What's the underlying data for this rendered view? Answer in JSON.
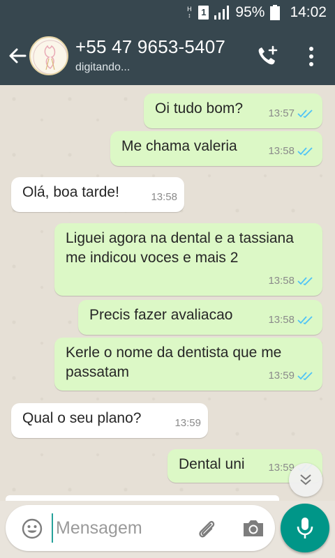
{
  "status_bar": {
    "network": "H",
    "sim": "1",
    "battery": "95%",
    "time": "14:02"
  },
  "header": {
    "contact_name": "+55 47 9653-5407",
    "status": "digitando...",
    "icons": [
      "back-arrow-icon",
      "add-call-icon",
      "more-vert-icon"
    ]
  },
  "messages": [
    {
      "direction": "out",
      "text": "Oi tudo bom?",
      "time": "13:57",
      "read": true
    },
    {
      "direction": "out",
      "text": "Me chama valeria",
      "time": "13:58",
      "read": true
    },
    {
      "direction": "in",
      "text": "Olá, boa tarde!",
      "time": "13:58"
    },
    {
      "direction": "out",
      "text": "Liguei agora na dental e a tassiana me indicou voces e mais 2",
      "time": "13:58",
      "read": true
    },
    {
      "direction": "out",
      "text": "Precis fazer avaliacao",
      "time": "13:58",
      "read": true
    },
    {
      "direction": "out",
      "text": "Kerle o nome da dentista que me passatam",
      "time": "13:59",
      "read": true
    },
    {
      "direction": "in",
      "text": "Qual o seu plano?",
      "time": "13:59"
    },
    {
      "direction": "out",
      "text": "Dental uni",
      "time": "13:59",
      "read": true
    }
  ],
  "composer": {
    "placeholder": "Mensagem",
    "value": ""
  },
  "colors": {
    "header": "#37474f",
    "outgoing_bubble": "#dcf8c6",
    "incoming_bubble": "#ffffff",
    "read_ticks": "#4fc3f7",
    "mic_button": "#009688"
  }
}
